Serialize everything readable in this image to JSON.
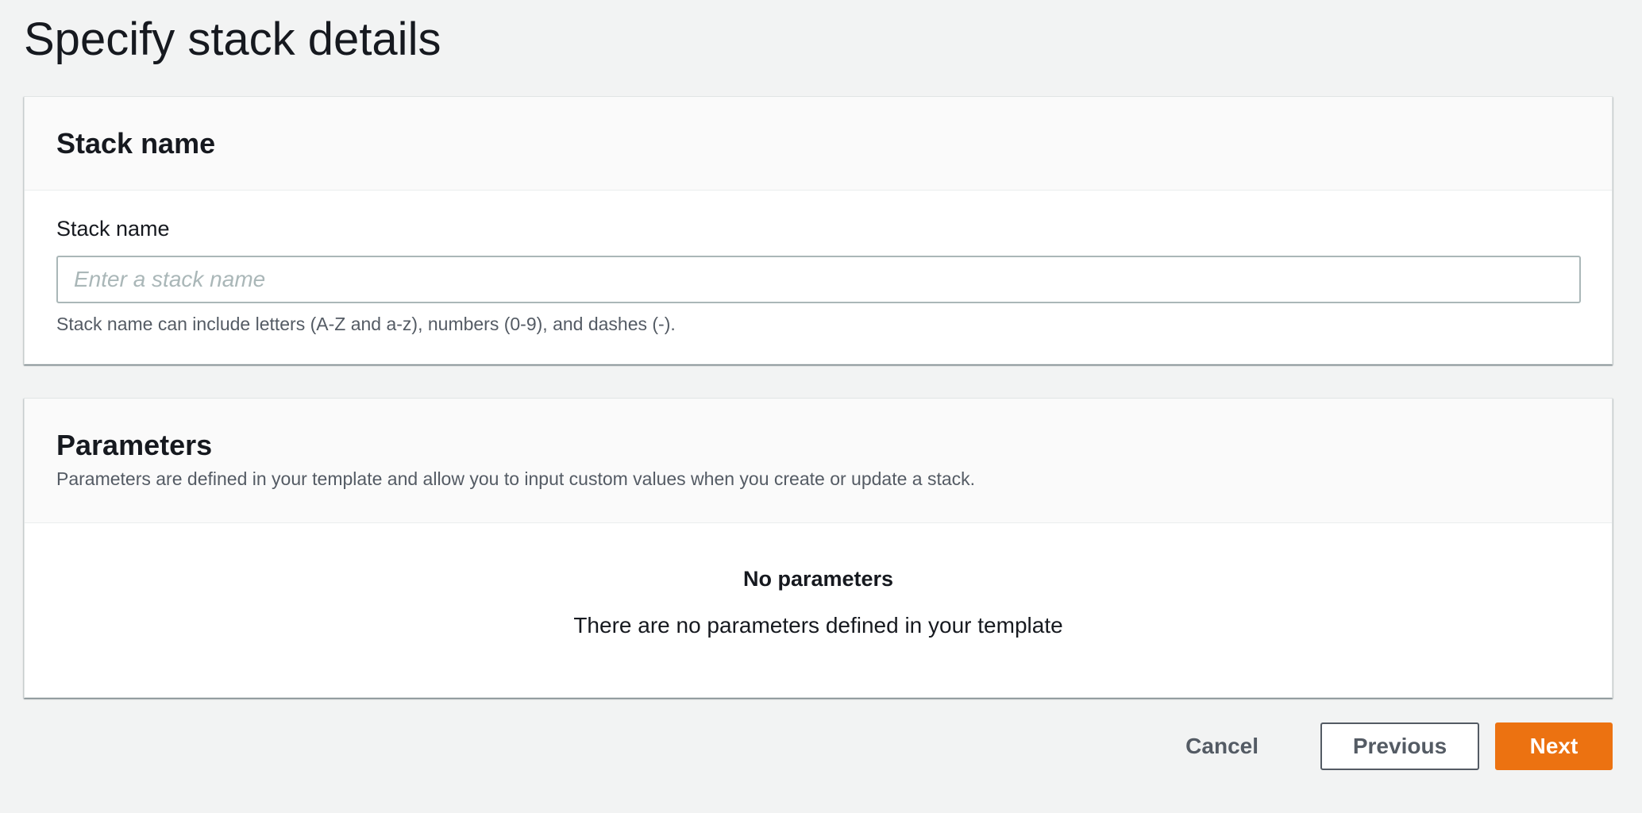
{
  "page": {
    "title": "Specify stack details"
  },
  "stack_name_section": {
    "heading": "Stack name",
    "field_label": "Stack name",
    "input_value": "",
    "input_placeholder": "Enter a stack name",
    "hint": "Stack name can include letters (A-Z and a-z), numbers (0-9), and dashes (-)."
  },
  "parameters_section": {
    "heading": "Parameters",
    "description": "Parameters are defined in your template and allow you to input custom values when you create or update a stack.",
    "empty_title": "No parameters",
    "empty_text": "There are no parameters defined in your template"
  },
  "actions": {
    "cancel_label": "Cancel",
    "previous_label": "Previous",
    "next_label": "Next"
  },
  "colors": {
    "primary_button": "#ec7211",
    "page_background": "#f2f3f3",
    "text": "#16191f",
    "secondary_text": "#545b64"
  }
}
